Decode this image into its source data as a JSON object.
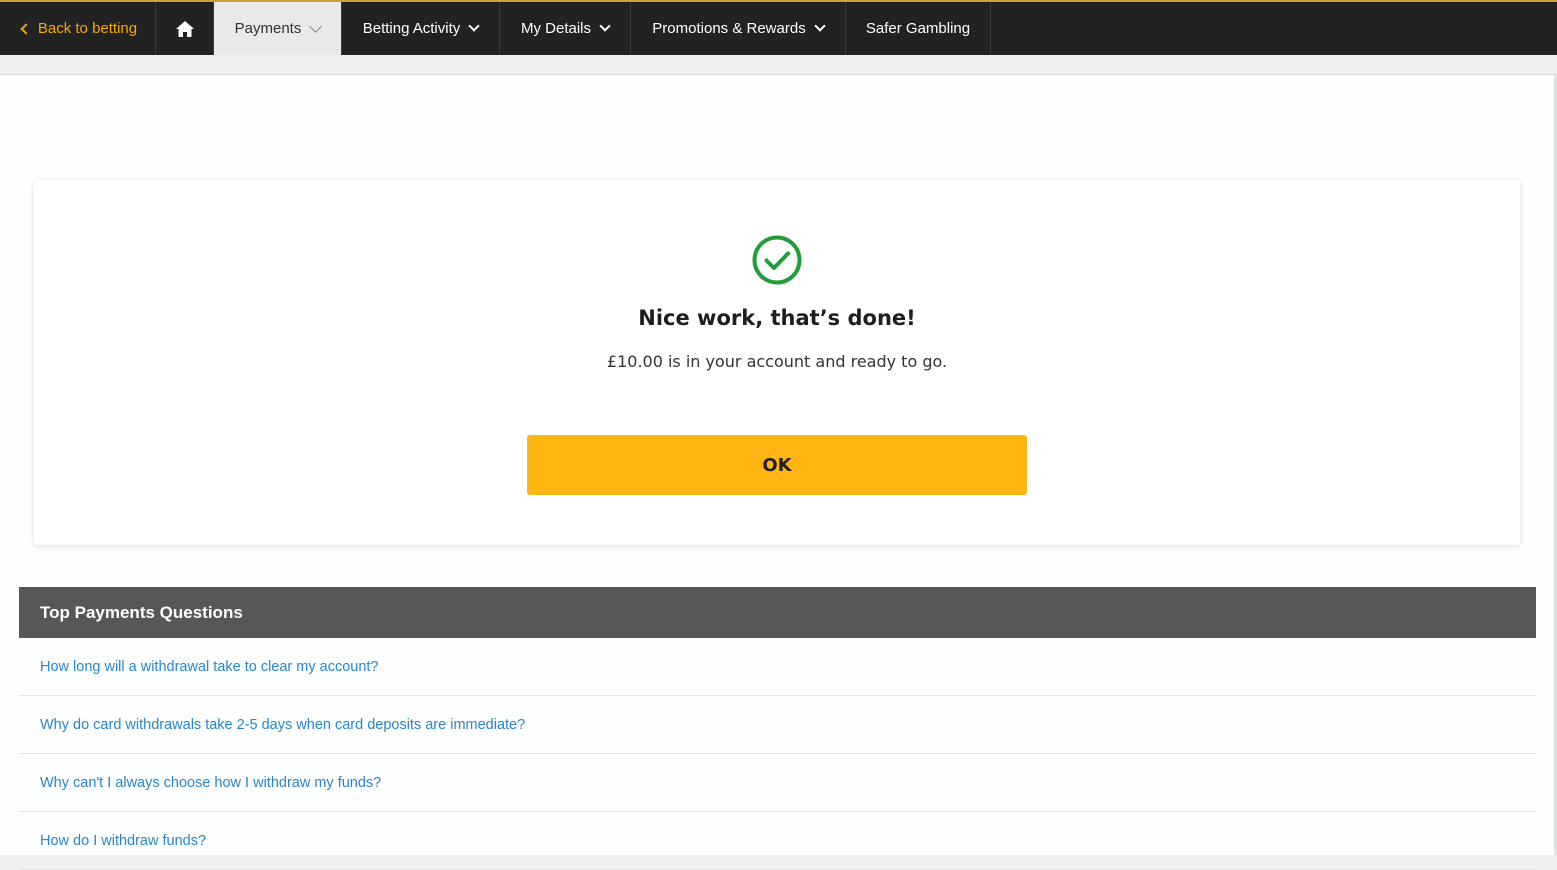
{
  "nav": {
    "back_label": "Back to betting",
    "home_icon": "home-icon",
    "items": [
      {
        "label": "Payments"
      },
      {
        "label": "Betting Activity"
      },
      {
        "label": "My Details"
      },
      {
        "label": "Promotions & Rewards"
      },
      {
        "label": "Safer Gambling"
      }
    ]
  },
  "confirmation": {
    "icon": "check-circle-icon",
    "title": "Nice work, that’s done!",
    "message": "£10.00 is in your account and ready to go.",
    "ok_label": "OK"
  },
  "faq": {
    "title": "Top Payments Questions",
    "questions": [
      "How long will a withdrawal take to clear my account?",
      "Why do card withdrawals take 2-5 days when card deposits are immediate?",
      "Why can't I always choose how I withdraw my funds?",
      "How do I withdraw funds?"
    ]
  },
  "colors": {
    "accent": "#ffb612",
    "success": "#1f9e3a",
    "link": "#2a86c8",
    "nav_background": "#222222"
  }
}
